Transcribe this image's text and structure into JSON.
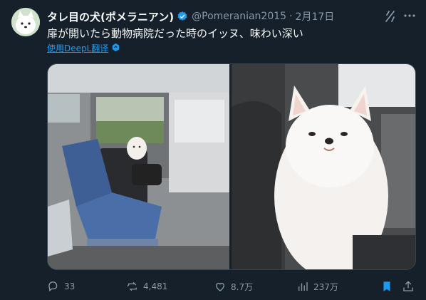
{
  "author": {
    "name": "タレ目の犬(ポメラニアン)",
    "handle": "@Pomeranian2015",
    "separator": "·",
    "date": "2月17日"
  },
  "tweet_text": "扉が開いたら動物病院だった時のイッヌ、味わい深い",
  "translate_label": "使用DeepL翻译",
  "actions": {
    "replies": "33",
    "retweets": "4,481",
    "likes": "8.7万",
    "views": "237万"
  },
  "colors": {
    "background": "#15202b",
    "accent": "#1d9bf0",
    "muted": "#8b98a5"
  },
  "icons": [
    "verified-icon",
    "grok-icon",
    "more-icon",
    "translate-icon",
    "reply-icon",
    "retweet-icon",
    "like-icon",
    "views-icon",
    "bookmark-icon",
    "share-icon"
  ]
}
